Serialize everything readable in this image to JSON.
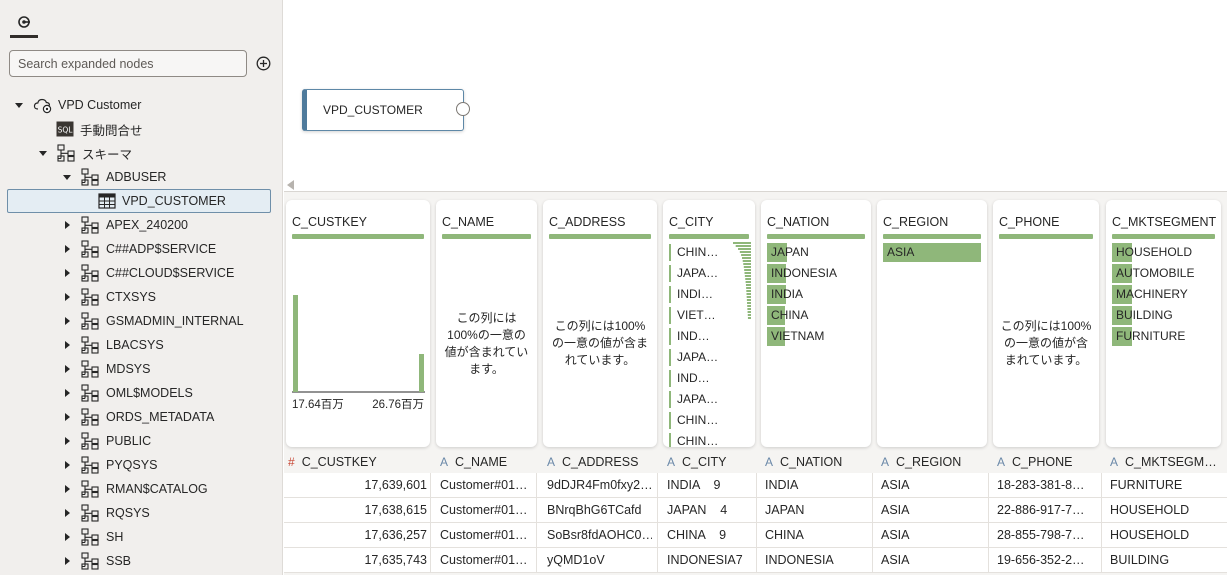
{
  "navigator": {
    "search_placeholder": "Search expanded nodes",
    "tree": [
      {
        "label": "VPD Customer",
        "icon": "cloud-db-icon",
        "depth": 0,
        "expanded": true
      },
      {
        "label": "手動問合せ",
        "icon": "sql-icon",
        "depth": 1,
        "expanded": null
      },
      {
        "label": "スキーマ",
        "icon": "schema-icon",
        "depth": 1,
        "expanded": true
      },
      {
        "label": "ADBUSER",
        "icon": "schema-icon",
        "depth": 2,
        "expanded": true
      },
      {
        "label": "VPD_CUSTOMER",
        "icon": "table-icon",
        "depth": 3,
        "expanded": null,
        "selected": true
      },
      {
        "label": "APEX_240200",
        "icon": "schema-icon",
        "depth": 2,
        "expanded": false
      },
      {
        "label": "C##ADP$SERVICE",
        "icon": "schema-icon",
        "depth": 2,
        "expanded": false
      },
      {
        "label": "C##CLOUD$SERVICE",
        "icon": "schema-icon",
        "depth": 2,
        "expanded": false
      },
      {
        "label": "CTXSYS",
        "icon": "schema-icon",
        "depth": 2,
        "expanded": false
      },
      {
        "label": "GSMADMIN_INTERNAL",
        "icon": "schema-icon",
        "depth": 2,
        "expanded": false
      },
      {
        "label": "LBACSYS",
        "icon": "schema-icon",
        "depth": 2,
        "expanded": false
      },
      {
        "label": "MDSYS",
        "icon": "schema-icon",
        "depth": 2,
        "expanded": false
      },
      {
        "label": "OML$MODELS",
        "icon": "schema-icon",
        "depth": 2,
        "expanded": false
      },
      {
        "label": "ORDS_METADATA",
        "icon": "schema-icon",
        "depth": 2,
        "expanded": false
      },
      {
        "label": "PUBLIC",
        "icon": "schema-icon",
        "depth": 2,
        "expanded": false
      },
      {
        "label": "PYQSYS",
        "icon": "schema-icon",
        "depth": 2,
        "expanded": false
      },
      {
        "label": "RMAN$CATALOG",
        "icon": "schema-icon",
        "depth": 2,
        "expanded": false
      },
      {
        "label": "RQSYS",
        "icon": "schema-icon",
        "depth": 2,
        "expanded": false
      },
      {
        "label": "SH",
        "icon": "schema-icon",
        "depth": 2,
        "expanded": false
      },
      {
        "label": "SSB",
        "icon": "schema-icon",
        "depth": 2,
        "expanded": false
      }
    ]
  },
  "canvas": {
    "node_label": "VPD_CUSTOMER"
  },
  "colors": {
    "accent_green": "#8fb77a",
    "node_border": "#4e7a9b",
    "numeric_type": "#c74634",
    "text_type": "#6a88a8"
  },
  "profile": {
    "unique_msg_custkey_name": "この列には100%の一意の値が含まれています。",
    "custkey": {
      "title": "C_CUSTKEY",
      "histogram_left_level": 0.97,
      "histogram_right_level": 0.38,
      "min_label": "17.64百万",
      "max_label": "26.76百万"
    },
    "name": {
      "title": "C_NAME",
      "message": "この列には100%の一意の値が含まれています。"
    },
    "address": {
      "title": "C_ADDRESS",
      "message": "この列には100%の一意の値が含まれています。"
    },
    "city": {
      "title": "C_CITY",
      "items": [
        "CHIN…",
        "JAPA…",
        "INDI…",
        "VIET…",
        "IND…",
        "JAPA…",
        "IND…",
        "JAPA…",
        "CHIN…",
        "CHIN…"
      ],
      "mini_bars": [
        1.0,
        0.85,
        0.72,
        0.62,
        0.55,
        0.5,
        0.46,
        0.43,
        0.4,
        0.38,
        0.36,
        0.34,
        0.32,
        0.3,
        0.28,
        0.27,
        0.26,
        0.25,
        0.24,
        0.23,
        0.22,
        0.21,
        0.2,
        0.19,
        0.18,
        0.17
      ]
    },
    "nation": {
      "title": "C_NATION",
      "items": [
        {
          "label": "JAPAN",
          "share": 0.2
        },
        {
          "label": "INDONESIA",
          "share": 0.19
        },
        {
          "label": "INDIA",
          "share": 0.19
        },
        {
          "label": "CHINA",
          "share": 0.18
        },
        {
          "label": "VIETNAM",
          "share": 0.18
        }
      ]
    },
    "region": {
      "title": "C_REGION",
      "items": [
        {
          "label": "ASIA",
          "share": 1.0
        }
      ]
    },
    "phone": {
      "title": "C_PHONE",
      "message": "この列には100%の一意の値が含まれています。"
    },
    "mktsegment": {
      "title": "C_MKTSEGMENT",
      "items": [
        {
          "label": "HOUSEHOLD",
          "share": 0.2
        },
        {
          "label": "AUTOMOBILE",
          "share": 0.2
        },
        {
          "label": "MACHINERY",
          "share": 0.2
        },
        {
          "label": "BUILDING",
          "share": 0.2
        },
        {
          "label": "FURNITURE",
          "share": 0.2
        }
      ]
    }
  },
  "columns": [
    {
      "name": "C_CUSTKEY",
      "type": "#"
    },
    {
      "name": "C_NAME",
      "type": "A"
    },
    {
      "name": "C_ADDRESS",
      "type": "A"
    },
    {
      "name": "C_CITY",
      "type": "A"
    },
    {
      "name": "C_NATION",
      "type": "A"
    },
    {
      "name": "C_REGION",
      "type": "A"
    },
    {
      "name": "C_PHONE",
      "type": "A"
    },
    {
      "name": "C_MKTSEGM…",
      "type": "A"
    }
  ],
  "rows": [
    [
      "17,639,601",
      "Customer#01…",
      "9dDJR4Fm0fxy2…",
      "INDIA    9",
      "INDIA",
      "ASIA",
      "18-283-381-8…",
      "FURNITURE"
    ],
    [
      "17,638,615",
      "Customer#01…",
      "BNrqBhG6TCafd",
      "JAPAN    4",
      "JAPAN",
      "ASIA",
      "22-886-917-7…",
      "HOUSEHOLD"
    ],
    [
      "17,636,257",
      "Customer#01…",
      "SoBsr8fdAOHC0…",
      "CHINA    9",
      "CHINA",
      "ASIA",
      "28-855-798-7…",
      "HOUSEHOLD"
    ],
    [
      "17,635,743",
      "Customer#01…",
      "yQMD1oV",
      "INDONESIA7",
      "INDONESIA",
      "ASIA",
      "19-656-352-2…",
      "BUILDING"
    ]
  ]
}
